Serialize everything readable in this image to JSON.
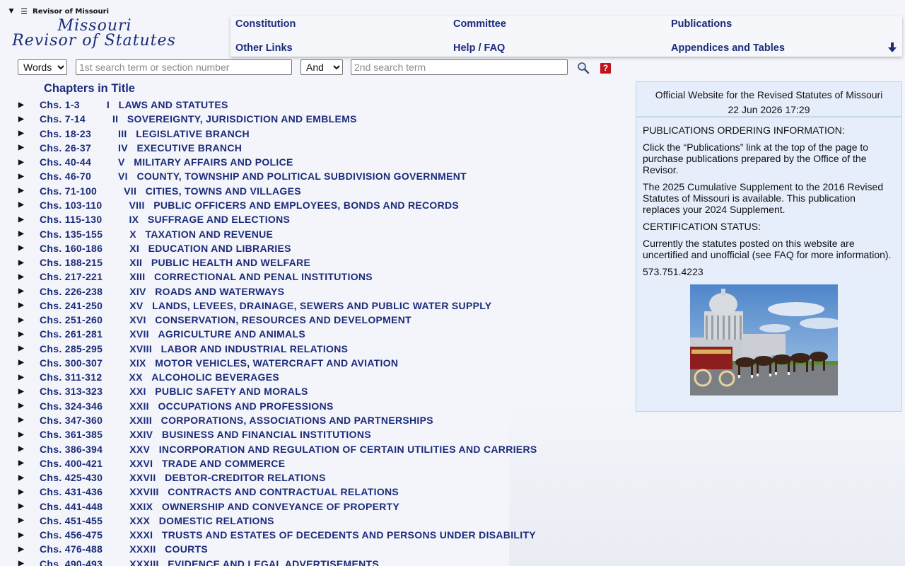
{
  "header": {
    "site_label": "Revisor of Missouri",
    "logo_line1": "Missouri",
    "logo_line2": "Revisor of Statutes",
    "nav": [
      {
        "label": "Constitution"
      },
      {
        "label": "Committee"
      },
      {
        "label": "Publications"
      },
      {
        "label": "Other Links"
      },
      {
        "label": "Help / FAQ"
      },
      {
        "label": "Appendices and Tables"
      }
    ]
  },
  "search": {
    "type_value": "Words",
    "term1_placeholder": "1st search term or section number",
    "operator_value": "And",
    "term2_placeholder": "2nd search term",
    "help_label": "?"
  },
  "chapters": {
    "heading": "Chapters in Title",
    "items": [
      {
        "range": "Chs. 1-3",
        "num": "I",
        "title": "LAWS AND STATUTES"
      },
      {
        "range": "Chs. 7-14",
        "num": "II",
        "title": "SOVEREIGNTY, JURISDICTION AND EMBLEMS"
      },
      {
        "range": "Chs. 18-23",
        "num": "III",
        "title": "LEGISLATIVE BRANCH"
      },
      {
        "range": "Chs. 26-37",
        "num": "IV",
        "title": "EXECUTIVE BRANCH"
      },
      {
        "range": "Chs. 40-44",
        "num": "V",
        "title": "MILITARY AFFAIRS AND POLICE"
      },
      {
        "range": "Chs. 46-70",
        "num": "VI",
        "title": "COUNTY, TOWNSHIP AND POLITICAL SUBDIVISION GOVERNMENT"
      },
      {
        "range": "Chs. 71-100",
        "num": "VII",
        "title": "CITIES, TOWNS AND VILLAGES"
      },
      {
        "range": "Chs. 103-110",
        "num": "VIII",
        "title": "PUBLIC OFFICERS AND EMPLOYEES, BONDS AND RECORDS"
      },
      {
        "range": "Chs. 115-130",
        "num": "IX",
        "title": "SUFFRAGE AND ELECTIONS"
      },
      {
        "range": "Chs. 135-155",
        "num": "X",
        "title": "TAXATION AND REVENUE"
      },
      {
        "range": "Chs. 160-186",
        "num": "XI",
        "title": "EDUCATION AND LIBRARIES"
      },
      {
        "range": "Chs. 188-215",
        "num": "XII",
        "title": "PUBLIC HEALTH AND WELFARE"
      },
      {
        "range": "Chs. 217-221",
        "num": "XIII",
        "title": "CORRECTIONAL AND PENAL INSTITUTIONS"
      },
      {
        "range": "Chs. 226-238",
        "num": "XIV",
        "title": "ROADS AND WATERWAYS"
      },
      {
        "range": "Chs. 241-250",
        "num": "XV",
        "title": "LANDS, LEVEES, DRAINAGE, SEWERS AND PUBLIC WATER SUPPLY"
      },
      {
        "range": "Chs. 251-260",
        "num": "XVI",
        "title": "CONSERVATION, RESOURCES AND DEVELOPMENT"
      },
      {
        "range": "Chs. 261-281",
        "num": "XVII",
        "title": "AGRICULTURE AND ANIMALS"
      },
      {
        "range": "Chs. 285-295",
        "num": "XVIII",
        "title": "LABOR AND INDUSTRIAL RELATIONS"
      },
      {
        "range": "Chs. 300-307",
        "num": "XIX",
        "title": "MOTOR VEHICLES, WATERCRAFT AND AVIATION"
      },
      {
        "range": "Chs. 311-312",
        "num": "XX",
        "title": "ALCOHOLIC BEVERAGES"
      },
      {
        "range": "Chs. 313-323",
        "num": "XXI",
        "title": "PUBLIC SAFETY AND MORALS"
      },
      {
        "range": "Chs. 324-346",
        "num": "XXII",
        "title": "OCCUPATIONS AND PROFESSIONS"
      },
      {
        "range": "Chs. 347-360",
        "num": "XXIII",
        "title": "CORPORATIONS, ASSOCIATIONS AND PARTNERSHIPS"
      },
      {
        "range": "Chs. 361-385",
        "num": "XXIV",
        "title": "BUSINESS AND FINANCIAL INSTITUTIONS"
      },
      {
        "range": "Chs. 386-394",
        "num": "XXV",
        "title": "INCORPORATION AND REGULATION OF CERTAIN UTILITIES AND CARRIERS"
      },
      {
        "range": "Chs. 400-421",
        "num": "XXVI",
        "title": "TRADE AND COMMERCE"
      },
      {
        "range": "Chs. 425-430",
        "num": "XXVII",
        "title": "DEBTOR-CREDITOR RELATIONS"
      },
      {
        "range": "Chs. 431-436",
        "num": "XXVIII",
        "title": "CONTRACTS AND CONTRACTUAL RELATIONS"
      },
      {
        "range": "Chs. 441-448",
        "num": "XXIX",
        "title": "OWNERSHIP AND CONVEYANCE OF PROPERTY"
      },
      {
        "range": "Chs. 451-455",
        "num": "XXX",
        "title": "DOMESTIC RELATIONS"
      },
      {
        "range": "Chs. 456-475",
        "num": "XXXI",
        "title": "TRUSTS AND ESTATES OF DECEDENTS AND PERSONS UNDER DISABILITY"
      },
      {
        "range": "Chs. 476-488",
        "num": "XXXII",
        "title": "COURTS"
      },
      {
        "range": "Chs. 490-493",
        "num": "XXXIII",
        "title": "EVIDENCE AND LEGAL ADVERTISEMENTS"
      }
    ]
  },
  "info": {
    "site_line": "Official Website for the Revised Statutes of Missouri",
    "datetime": "22 Jun 2026 17:29",
    "ordering_heading": "PUBLICATIONS ORDERING INFORMATION:",
    "ordering_text": "Click the “Publications” link at the top of the page to purchase publications prepared by the Office of the Revisor.",
    "supplement_text": "The 2025 Cumulative Supplement to the 2016 Revised Statutes of Missouri is available. This publication replaces your 2024 Supplement.",
    "cert_heading": "CERTIFICATION STATUS:",
    "cert_text": "Currently the statutes posted on this website are uncertified and unofficial (see FAQ for more information).",
    "phone": "573.751.4223"
  },
  "colors": {
    "brand_navy": "#1b2b7a",
    "panel_bg": "#e6eefb",
    "panel_border": "#b9d5ec",
    "help_red": "#c0141c"
  },
  "icons": [
    "collapse-triangle-icon",
    "hamburger-menu-icon",
    "down-arrow-icon",
    "search-icon",
    "help-icon",
    "expand-triangle-icon"
  ]
}
